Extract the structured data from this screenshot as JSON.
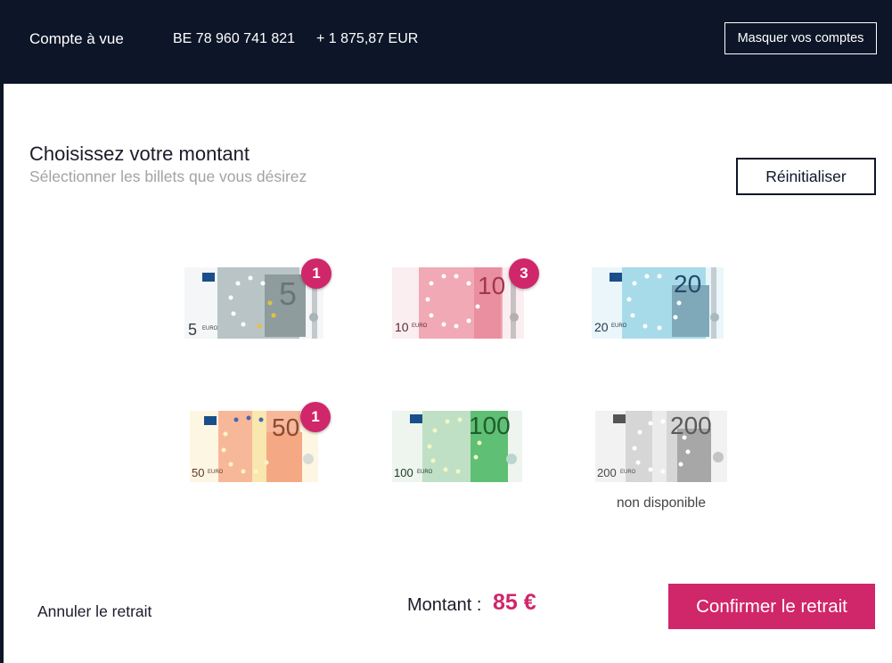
{
  "header": {
    "account_name": "Compte à vue",
    "iban": "BE 78 960 741 821",
    "balance": "+ 1 875,87 EUR",
    "hide_accounts_label": "Masquer vos comptes"
  },
  "selection": {
    "title": "Choisissez votre montant",
    "subtitle": "Sélectionner les billets que vous désirez",
    "reset_label": "Réinitialiser"
  },
  "notes": [
    {
      "denomination": "5",
      "euro_text": "EURO",
      "count": "1",
      "available": true,
      "color": "#b9c4c6"
    },
    {
      "denomination": "10",
      "euro_text": "EURO",
      "count": "3",
      "available": true,
      "color": "#f0a9b5"
    },
    {
      "denomination": "20",
      "euro_text": "EURO",
      "count": "",
      "available": true,
      "color": "#a8dbe9"
    },
    {
      "denomination": "50",
      "euro_text": "EURO",
      "count": "1",
      "available": true,
      "color": "#f7b89a"
    },
    {
      "denomination": "100",
      "euro_text": "EURO",
      "count": "",
      "available": true,
      "color": "#9fd2a6"
    },
    {
      "denomination": "200",
      "euro_text": "EURO",
      "count": "",
      "available": false,
      "color": "#c8c8c8"
    }
  ],
  "unavailable_label": "non disponible",
  "footer": {
    "cancel_label": "Annuler le retrait",
    "amount_label": "Montant :",
    "amount_value": "85 €",
    "confirm_label": "Confirmer le retrait"
  },
  "colors": {
    "navy": "#0d1628",
    "accent": "#d0266a"
  },
  "icons": {
    "badge": "count-badge-icon",
    "note": "banknote-icon"
  }
}
